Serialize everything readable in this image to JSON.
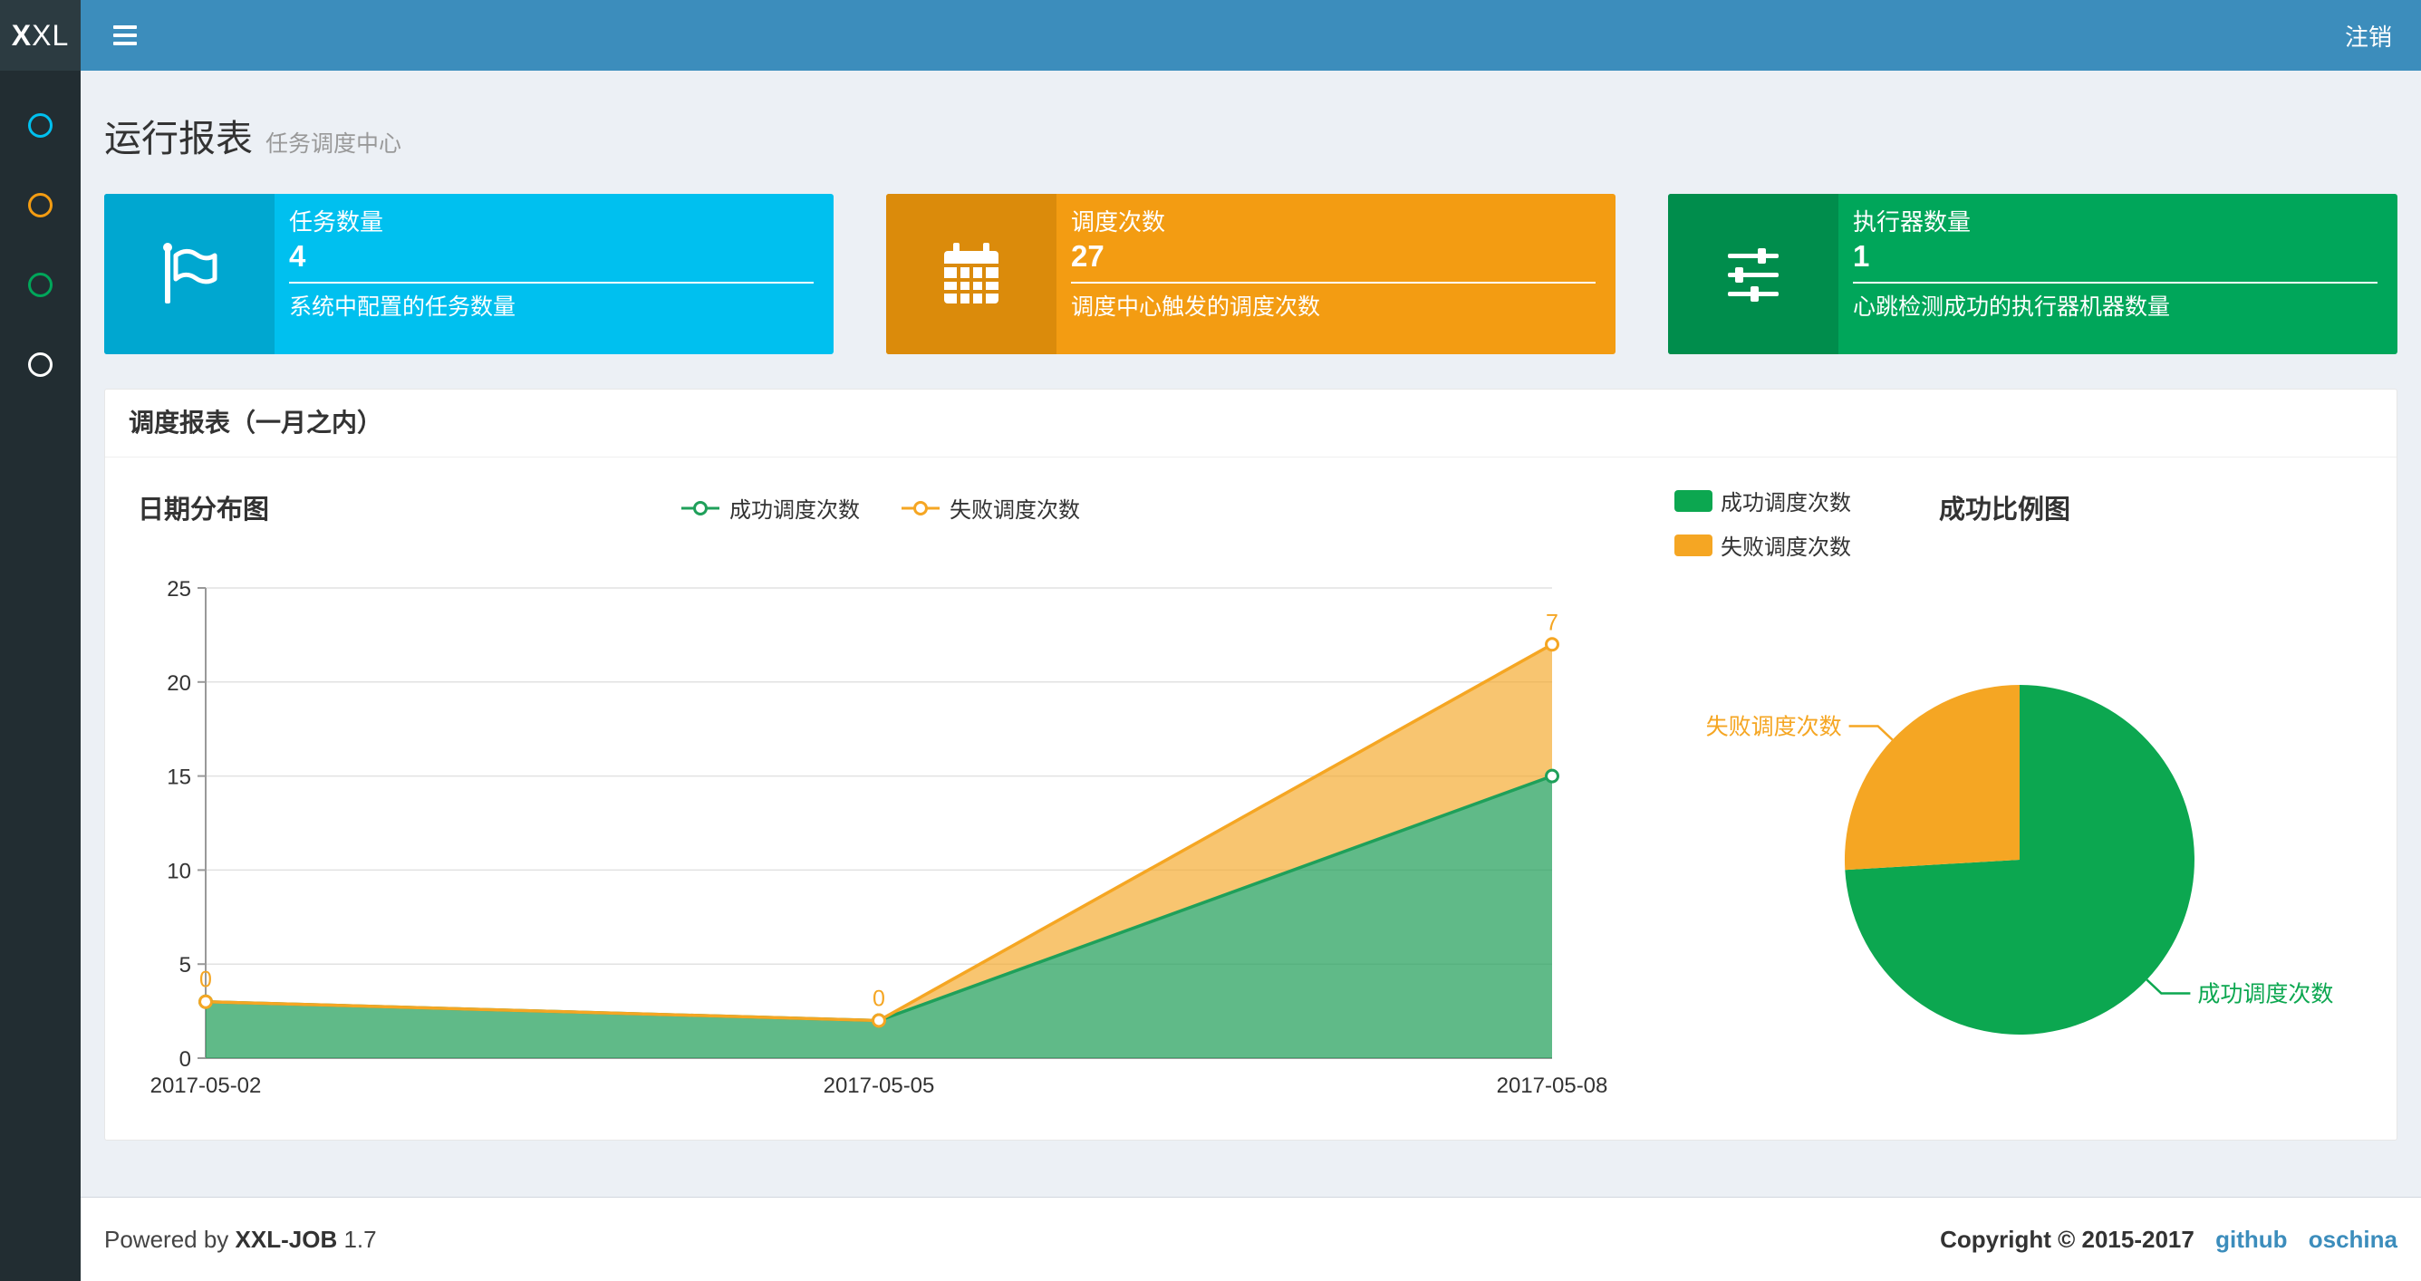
{
  "navbar": {
    "logo_bold": "X",
    "logo_rest": "XL",
    "logout": "注销"
  },
  "sidebar": {
    "items": [
      {
        "id": "report",
        "color": "#00c0ef"
      },
      {
        "id": "log",
        "color": "#f39c12"
      },
      {
        "id": "job",
        "color": "#00a65a"
      },
      {
        "id": "other",
        "color": "#ffffff"
      }
    ]
  },
  "page_header": {
    "title": "运行报表",
    "subtitle": "任务调度中心"
  },
  "info_boxes": [
    {
      "title": "任务数量",
      "value": "4",
      "desc": "系统中配置的任务数量",
      "bg": "#00c0ef",
      "icon_bg": "#00a7d0",
      "icon": "flag-icon"
    },
    {
      "title": "调度次数",
      "value": "27",
      "desc": "调度中心触发的调度次数",
      "bg": "#f39c12",
      "icon_bg": "#db8b0b",
      "icon": "calendar-icon"
    },
    {
      "title": "执行器数量",
      "value": "1",
      "desc": "心跳检测成功的执行器机器数量",
      "bg": "#00a65a",
      "icon_bg": "#008d4c",
      "icon": "sliders-icon"
    }
  ],
  "panel": {
    "title": "调度报表（一月之内）"
  },
  "chart_data": [
    {
      "type": "area",
      "title": "日期分布图",
      "stacked": true,
      "x": [
        "2017-05-02",
        "2017-05-05",
        "2017-05-08"
      ],
      "series": [
        {
          "name": "成功调度次数",
          "values": [
            3,
            2,
            15
          ],
          "color": "#1fa05a",
          "fill": "rgba(34,160,90,0.72)",
          "show_labels": false
        },
        {
          "name": "失败调度次数",
          "values": [
            0,
            0,
            7
          ],
          "color": "#f5a623",
          "fill": "rgba(245,166,35,0.65)",
          "show_labels": true
        }
      ],
      "ylim": [
        0,
        25
      ],
      "yticks": [
        0,
        5,
        10,
        15,
        20,
        25
      ],
      "legend_position": "top-center",
      "grid": true
    },
    {
      "type": "pie",
      "title": "成功比例图",
      "slices": [
        {
          "name": "成功调度次数",
          "value": 20,
          "color": "#0ca750"
        },
        {
          "name": "失败调度次数",
          "value": 7,
          "color": "#f5a623"
        }
      ],
      "legend_position": "top-left"
    }
  ],
  "footer": {
    "powered_prefix": "Powered by",
    "brand": "XXL-JOB",
    "version": "1.7",
    "copyright": "Copyright © 2015-2017",
    "links": [
      "github",
      "oschina"
    ]
  },
  "colors": {
    "navbar": "#3c8dbc",
    "logo_bg": "#2c3b41",
    "sidebar": "#222d32",
    "body_bg": "#ecf0f5",
    "link": "#3c8dbc"
  }
}
